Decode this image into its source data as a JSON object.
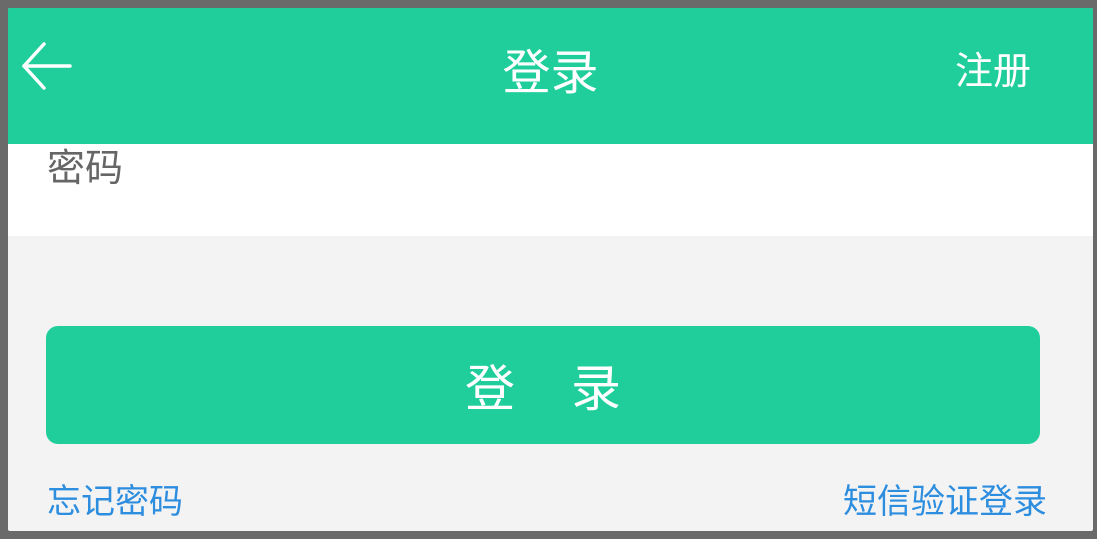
{
  "header": {
    "title": "登录",
    "register_label": "注册",
    "back_icon": "arrow-left-icon"
  },
  "form": {
    "password_label": "密码",
    "password_value": "",
    "login_button_label": "登录"
  },
  "links": {
    "forgot_password": "忘记密码",
    "sms_login": "短信验证登录"
  },
  "colors": {
    "accent": "#20ce9c",
    "link": "#2d8ddf",
    "background": "#f3f3f3"
  }
}
